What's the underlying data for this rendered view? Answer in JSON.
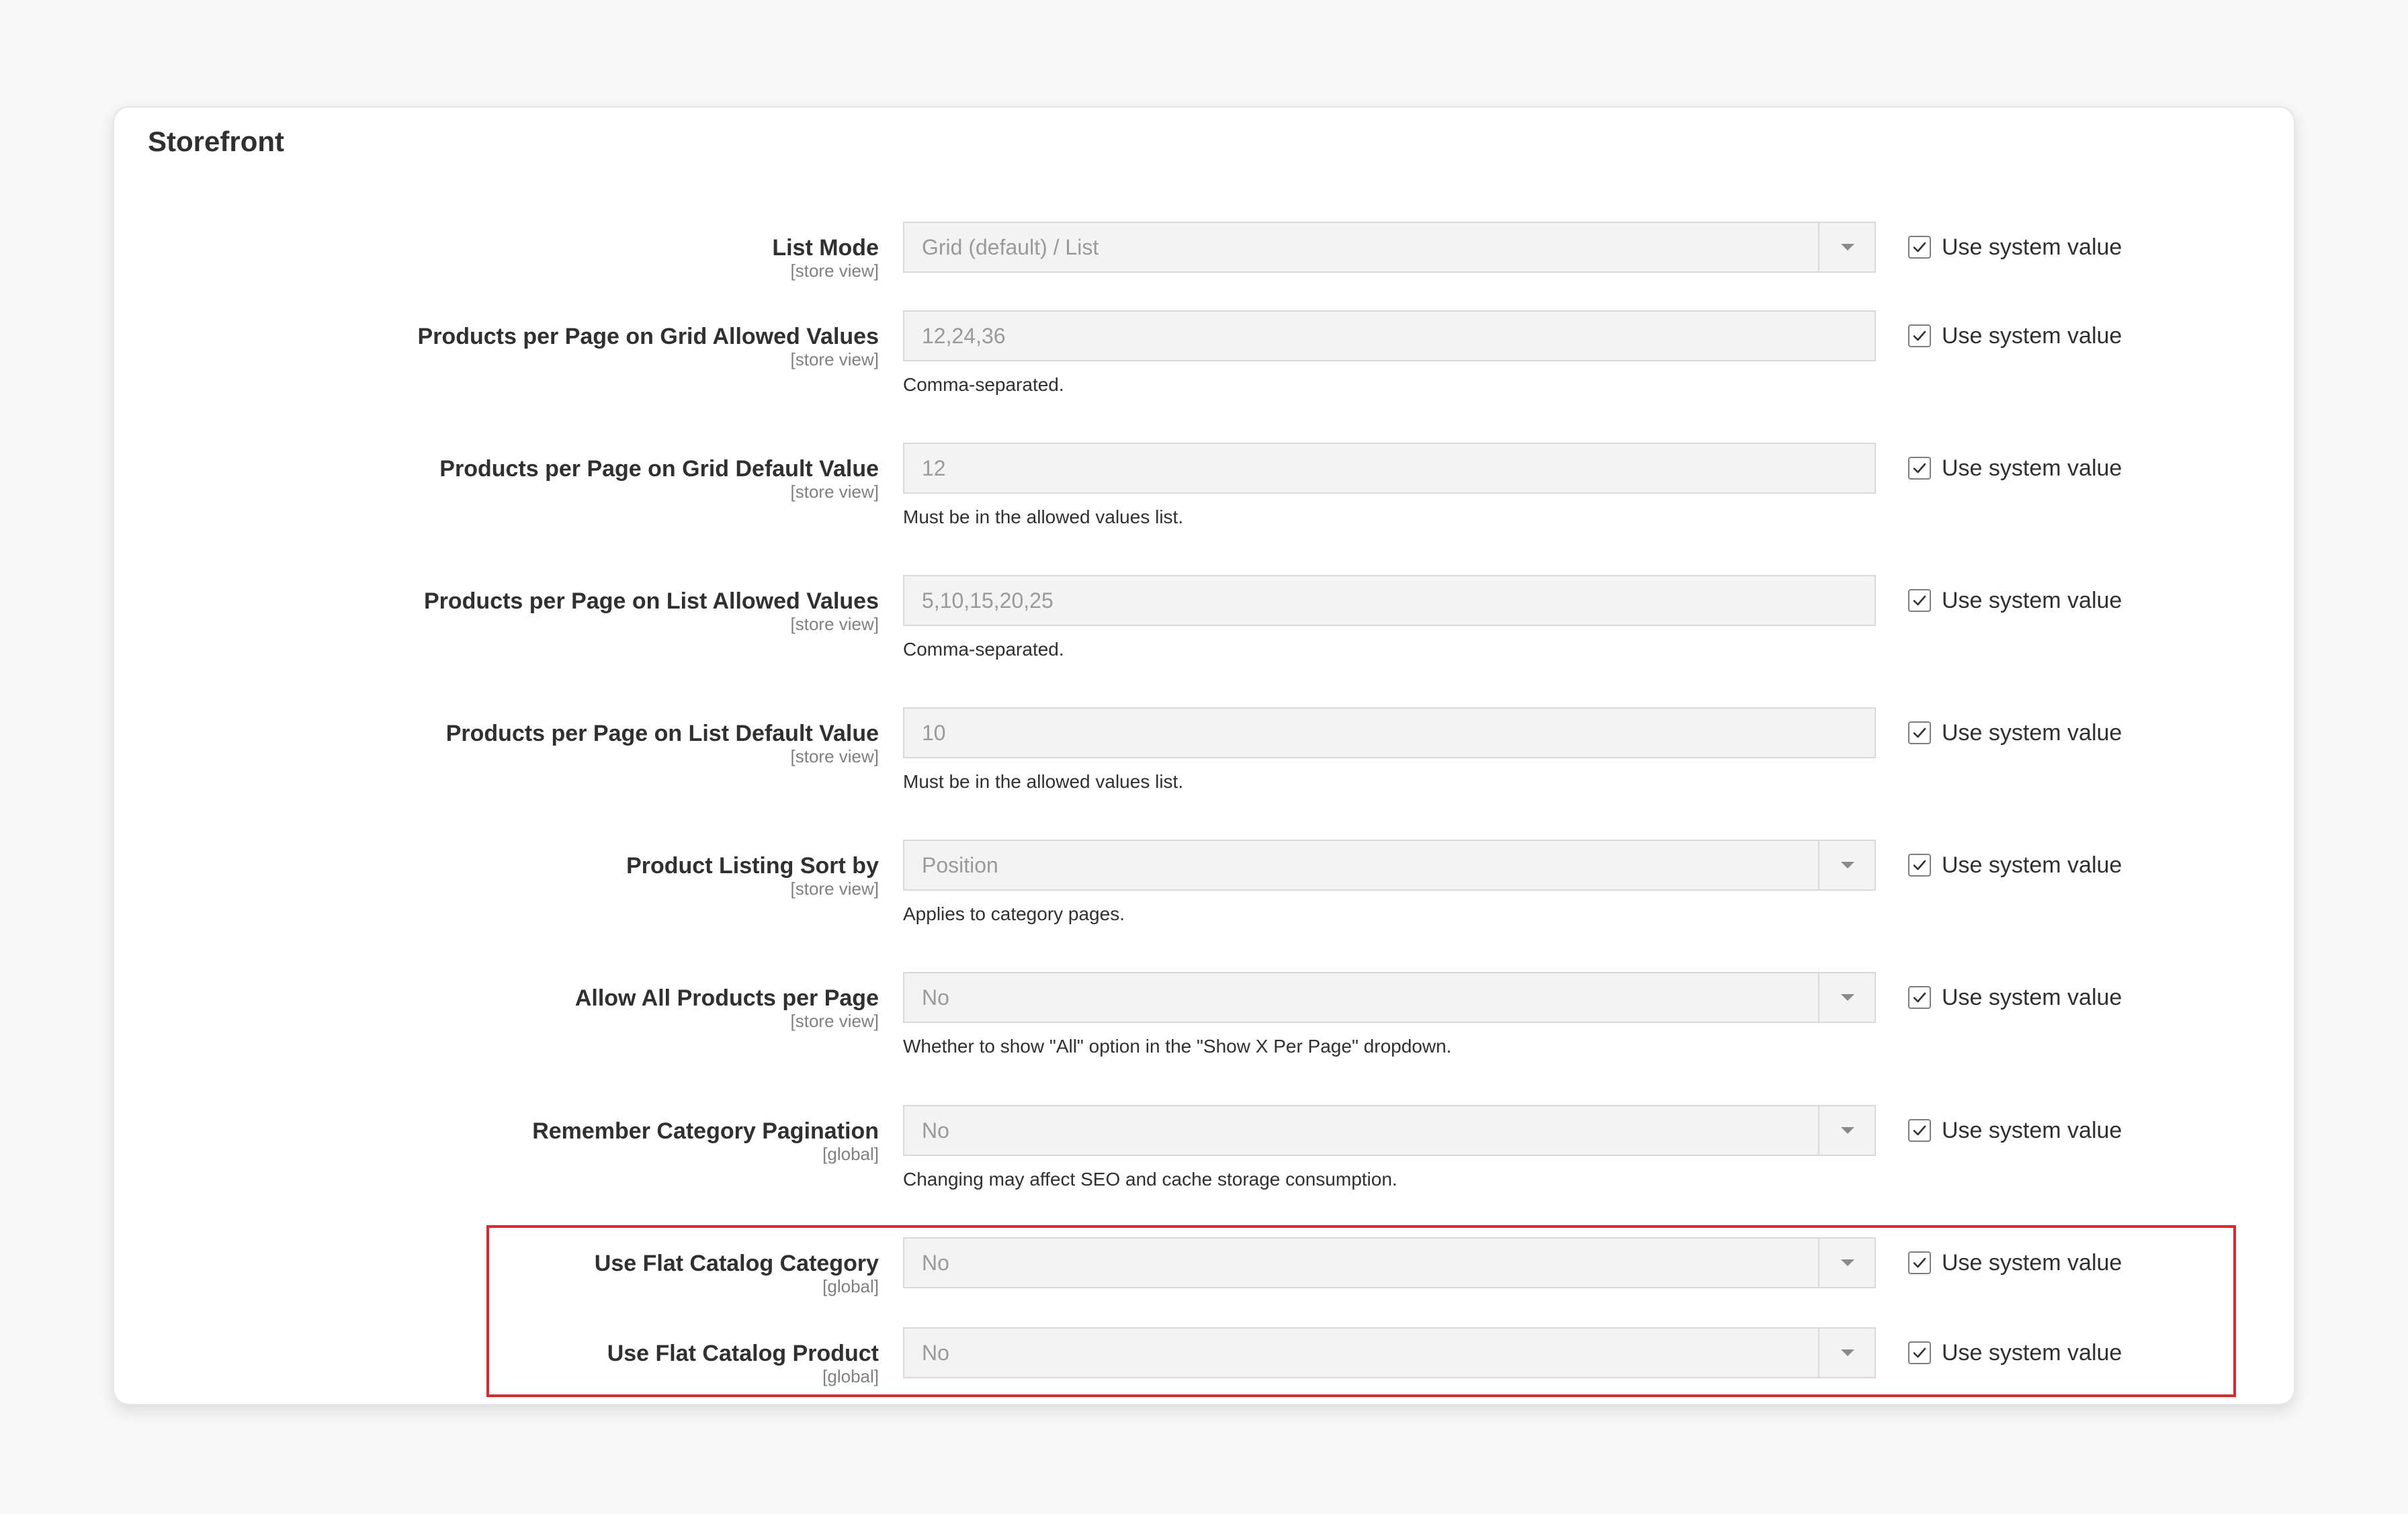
{
  "section": {
    "title": "Storefront"
  },
  "fields": [
    {
      "label": "List Mode",
      "scope": "[store view]",
      "value": "Grid (default) / List",
      "control": "select",
      "note": "",
      "checkbox_label": "Use system value",
      "checked": true
    },
    {
      "label": "Products per Page on Grid Allowed Values",
      "scope": "[store view]",
      "value": "12,24,36",
      "control": "input",
      "note": "Comma-separated.",
      "checkbox_label": "Use system value",
      "checked": true
    },
    {
      "label": "Products per Page on Grid Default Value",
      "scope": "[store view]",
      "value": "12",
      "control": "input",
      "note": "Must be in the allowed values list.",
      "checkbox_label": "Use system value",
      "checked": true
    },
    {
      "label": "Products per Page on List Allowed Values",
      "scope": "[store view]",
      "value": "5,10,15,20,25",
      "control": "input",
      "note": "Comma-separated.",
      "checkbox_label": "Use system value",
      "checked": true
    },
    {
      "label": "Products per Page on List Default Value",
      "scope": "[store view]",
      "value": "10",
      "control": "input",
      "note": "Must be in the allowed values list.",
      "checkbox_label": "Use system value",
      "checked": true
    },
    {
      "label": "Product Listing Sort by",
      "scope": "[store view]",
      "value": "Position",
      "control": "select",
      "note": "Applies to category pages.",
      "checkbox_label": "Use system value",
      "checked": true
    },
    {
      "label": "Allow All Products per Page",
      "scope": "[store view]",
      "value": "No",
      "control": "select",
      "note": "Whether to show \"All\" option in the \"Show X Per Page\" dropdown.",
      "checkbox_label": "Use system value",
      "checked": true
    },
    {
      "label": "Remember Category Pagination",
      "scope": "[global]",
      "value": "No",
      "control": "select",
      "note": "Changing may affect SEO and cache storage consumption.",
      "checkbox_label": "Use system value",
      "checked": true
    },
    {
      "label": "Use Flat Catalog Category",
      "scope": "[global]",
      "value": "No",
      "control": "select",
      "note": "",
      "checkbox_label": "Use system value",
      "checked": true
    },
    {
      "label": "Use Flat Catalog Product",
      "scope": "[global]",
      "value": "No",
      "control": "select",
      "note": "",
      "checkbox_label": "Use system value",
      "checked": true
    }
  ],
  "highlight": {
    "color": "#e0262c"
  },
  "icons": {
    "checkbox": "checkmark-icon",
    "dropdown": "chevron-down-icon"
  }
}
